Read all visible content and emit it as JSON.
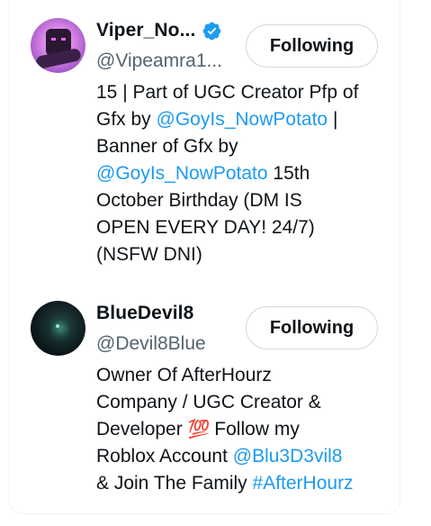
{
  "users": [
    {
      "display_name": "Viper_No...",
      "handle": "@Vipeamra1...",
      "verified": true,
      "follow_label": "Following",
      "bio": {
        "l1": "15 | Part of UGC Creator Pfp of",
        "l2_a": "Gfx by ",
        "l2_mention": "@GoyIs_NowPotato",
        "l2_b": " |",
        "l3": "Banner of Gfx by",
        "l4_mention": "@GoyIs_NowPotato",
        "l4_b": " 15th",
        "l5": "October Birthday (DM IS",
        "l6": "OPEN EVERY DAY! 24/7)",
        "l7": "(NSFW DNI)"
      }
    },
    {
      "display_name": "BlueDevil8",
      "handle": "@Devil8Blue",
      "verified": false,
      "follow_label": "Following",
      "bio": {
        "l1": "Owner Of AfterHourz",
        "l2": "Company / UGC Creator &",
        "l3_a": "Developer ",
        "l3_emoji": "💯",
        "l3_b": " Follow my",
        "l4_a": "Roblox Account ",
        "l4_mention": "@Blu3D3vil8",
        "l5_a": "& Join The Family ",
        "l5_hashtag": "#AfterHourz"
      }
    }
  ],
  "colors": {
    "link": "#1d9bf0",
    "secondary_text": "#536471",
    "verified_badge": "#1d9bf0",
    "border": "#cfd9de"
  },
  "icons": {
    "verified": "verified-badge-icon"
  }
}
